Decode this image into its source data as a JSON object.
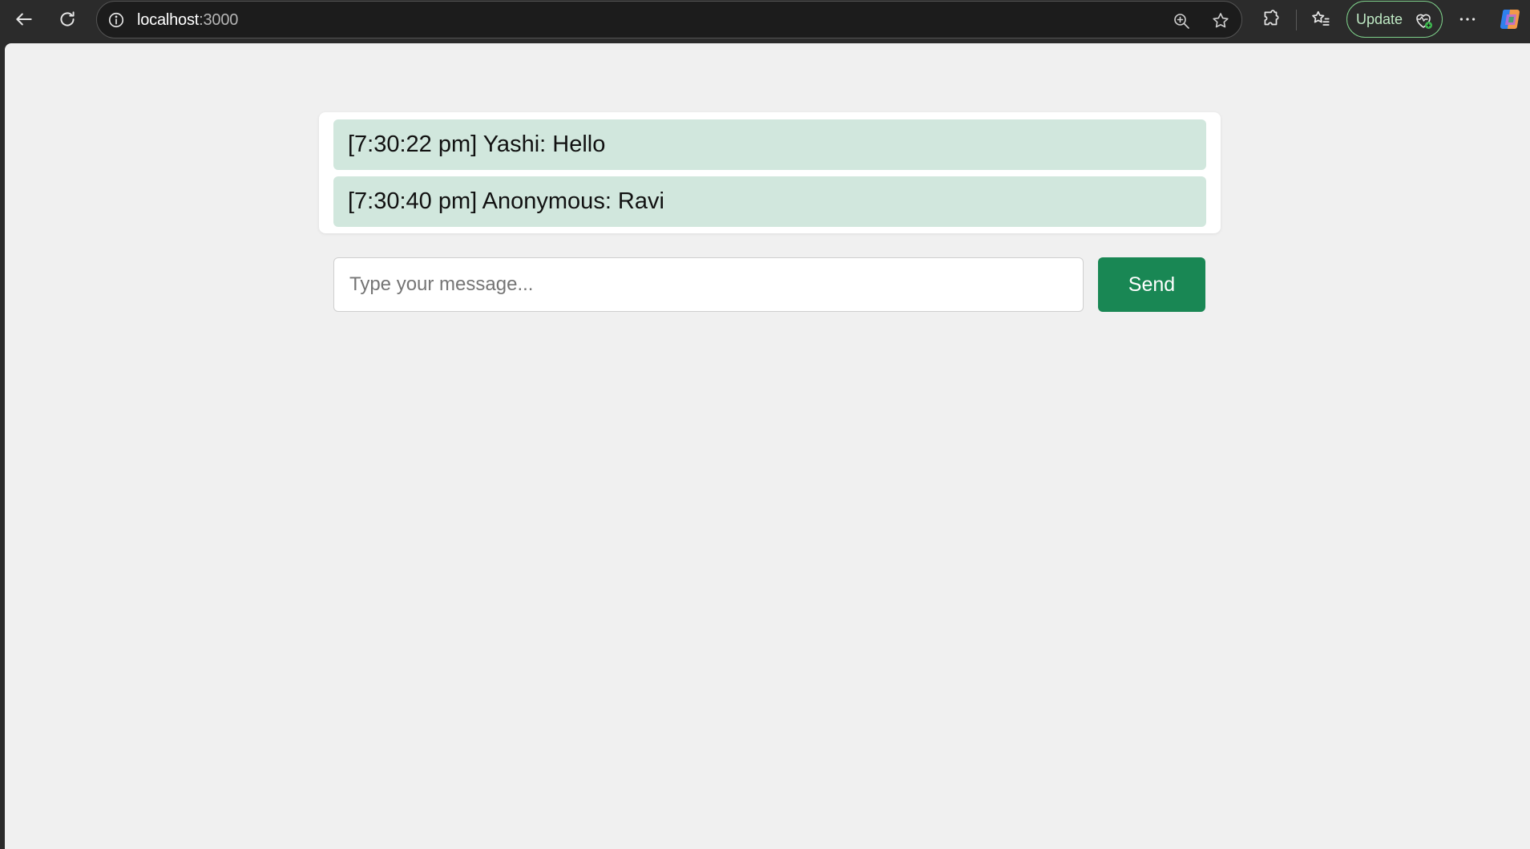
{
  "browser": {
    "address_bar": {
      "host": "localhost",
      "port": ":3000"
    },
    "update_button_label": "Update",
    "icons": {
      "back": "back-arrow-icon",
      "reload": "reload-icon",
      "site_info": "info-icon",
      "zoom": "zoom-in-icon",
      "favorite": "star-icon",
      "extensions": "puzzle-icon",
      "favorites": "favorites-list-icon",
      "update": "heart-pulse-icon",
      "more": "more-horizontal-icon",
      "copilot": "copilot-icon"
    }
  },
  "chat": {
    "messages": [
      {
        "text": "[7:30:22 pm] Yashi: Hello"
      },
      {
        "text": "[7:30:40 pm] Anonymous: Ravi"
      }
    ],
    "input": {
      "value": "",
      "placeholder": "Type your message..."
    },
    "send_label": "Send"
  },
  "colors": {
    "message_bg": "#d1e7dd",
    "send_button": "#198754",
    "page_bg": "#f0f0f0",
    "update_outline": "#7ed08a"
  }
}
